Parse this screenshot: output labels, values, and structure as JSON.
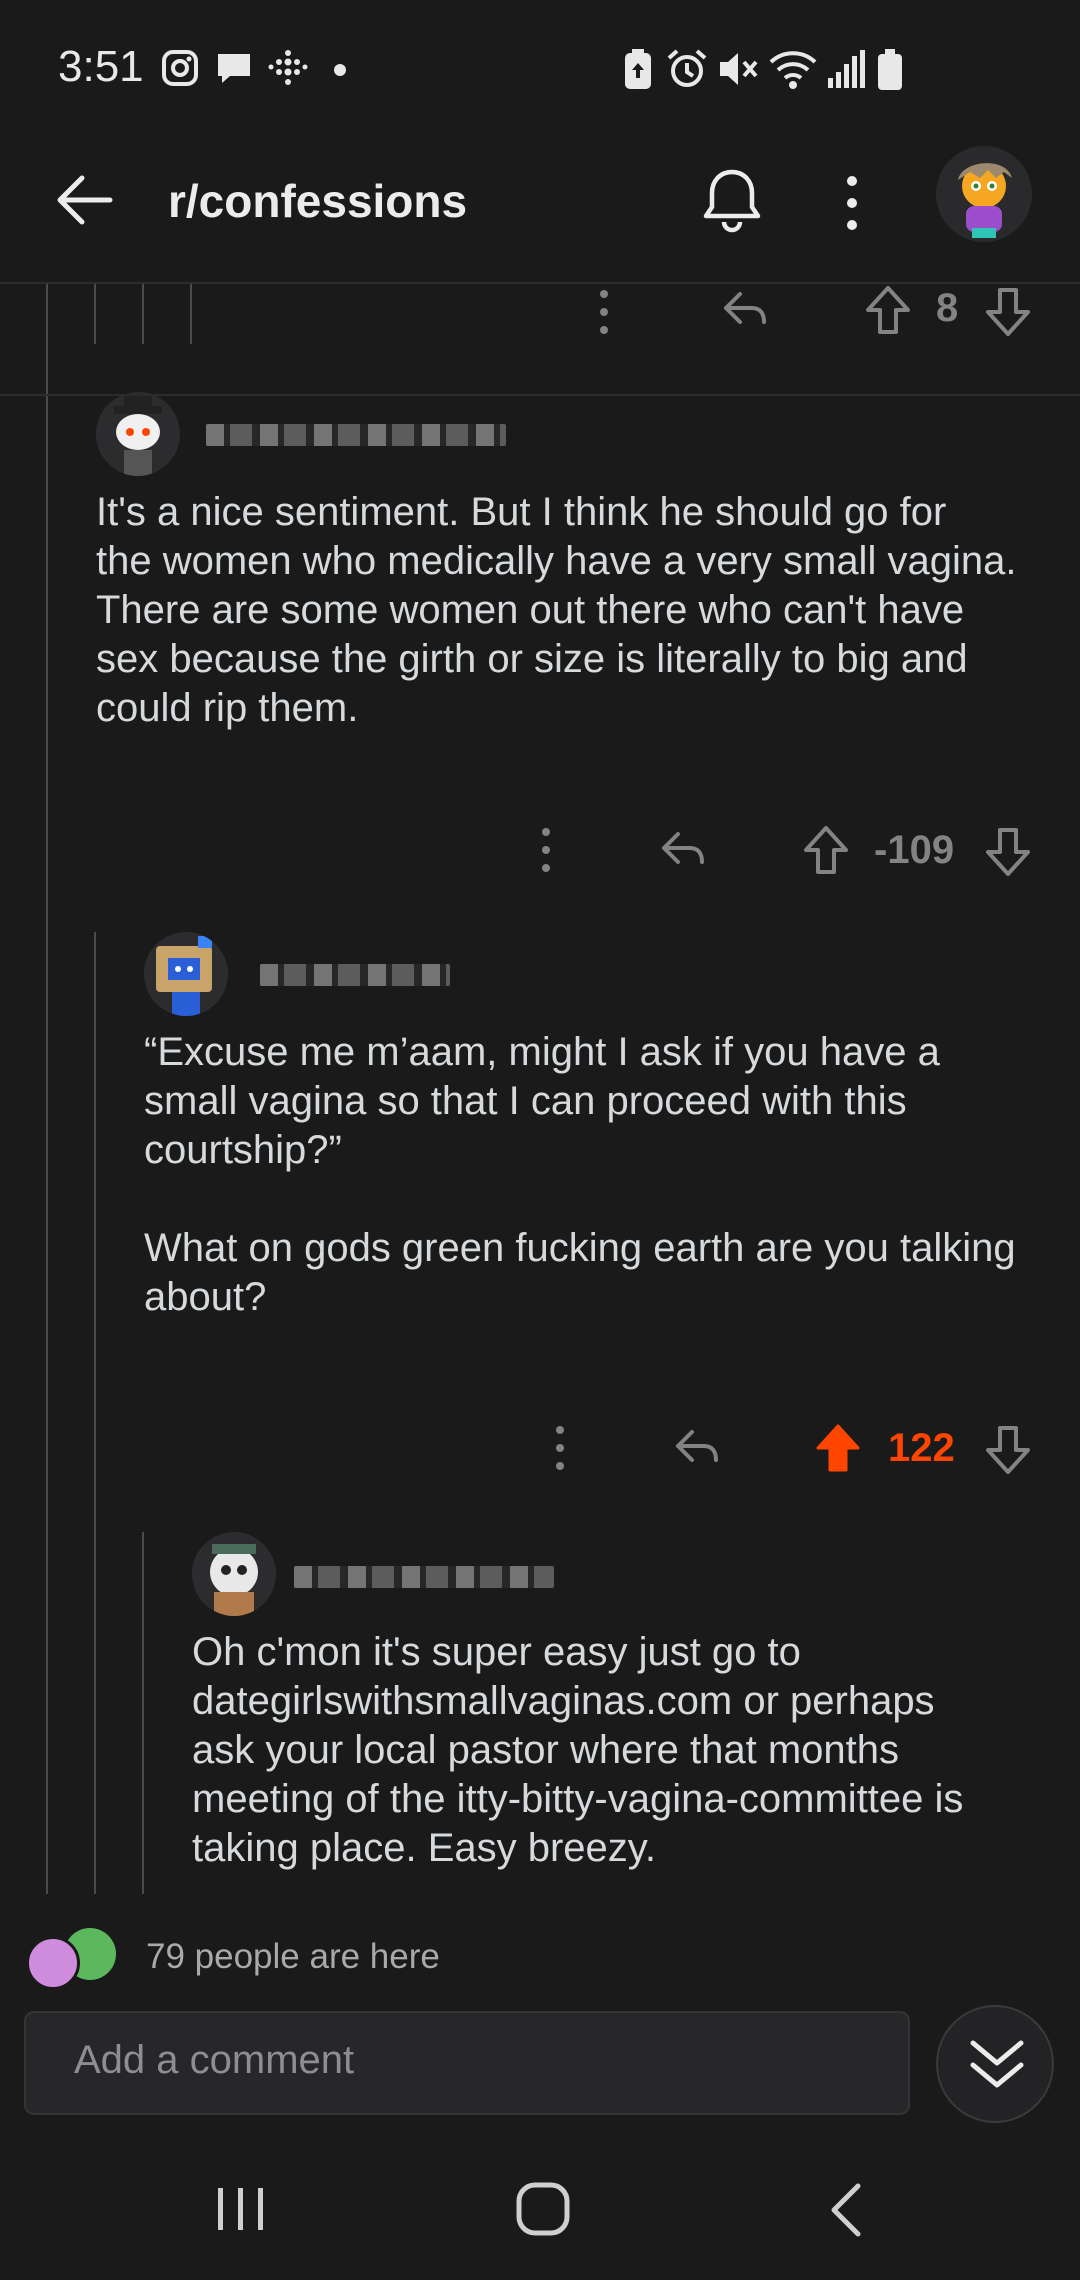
{
  "status_bar": {
    "time": "3:51"
  },
  "header": {
    "title": "r/confessions"
  },
  "top_row": {
    "score": "8"
  },
  "comments": [
    {
      "text": "It's a nice sentiment. But I think he should go for\nthe women who medically have a very small vagina.\nThere are some women out there who can't have\nsex because the girth or size is literally to big and\ncould rip them.",
      "score": "-109",
      "upvoted": false
    },
    {
      "text": "“Excuse me m’aam, might I ask if you have a\nsmall vagina so that I can proceed with this\ncourtship?”\n\nWhat on gods green fucking earth are you talking\nabout?",
      "score": "122",
      "upvoted": true
    },
    {
      "text": "Oh c'mon it's super easy just go to\ndategirlswithsmallvaginas.com or perhaps\nask your local pastor where that months\nmeeting of the itty-bitty-vagina-committee is\ntaking place. Easy breezy."
    }
  ],
  "presence": {
    "text": "79 people are here"
  },
  "composer": {
    "placeholder": "Add a comment"
  },
  "colors": {
    "upvote": "#ff4500",
    "background": "#1a1a1b"
  }
}
